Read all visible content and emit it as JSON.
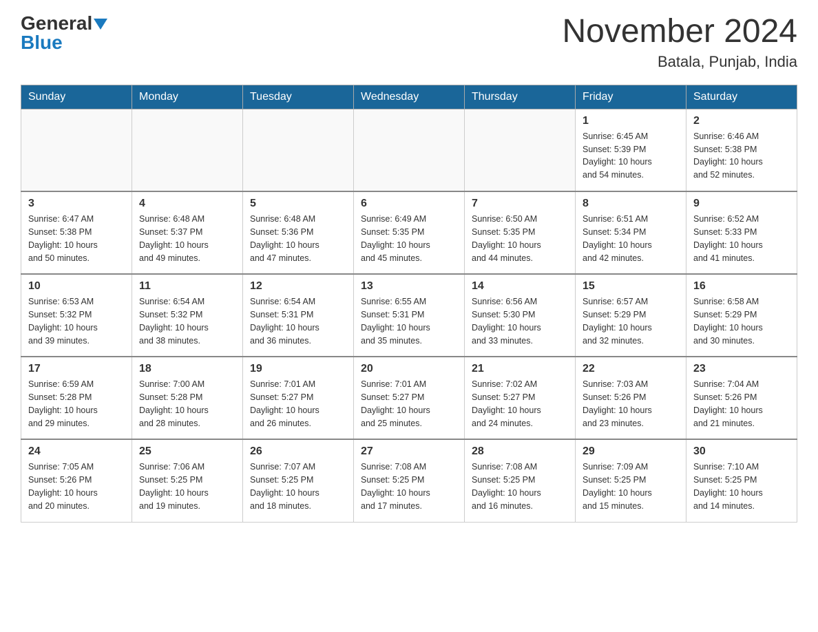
{
  "header": {
    "logo_general": "General",
    "logo_blue": "Blue",
    "month_title": "November 2024",
    "location": "Batala, Punjab, India"
  },
  "weekdays": [
    "Sunday",
    "Monday",
    "Tuesday",
    "Wednesday",
    "Thursday",
    "Friday",
    "Saturday"
  ],
  "weeks": [
    [
      {
        "day": "",
        "info": ""
      },
      {
        "day": "",
        "info": ""
      },
      {
        "day": "",
        "info": ""
      },
      {
        "day": "",
        "info": ""
      },
      {
        "day": "",
        "info": ""
      },
      {
        "day": "1",
        "info": "Sunrise: 6:45 AM\nSunset: 5:39 PM\nDaylight: 10 hours\nand 54 minutes."
      },
      {
        "day": "2",
        "info": "Sunrise: 6:46 AM\nSunset: 5:38 PM\nDaylight: 10 hours\nand 52 minutes."
      }
    ],
    [
      {
        "day": "3",
        "info": "Sunrise: 6:47 AM\nSunset: 5:38 PM\nDaylight: 10 hours\nand 50 minutes."
      },
      {
        "day": "4",
        "info": "Sunrise: 6:48 AM\nSunset: 5:37 PM\nDaylight: 10 hours\nand 49 minutes."
      },
      {
        "day": "5",
        "info": "Sunrise: 6:48 AM\nSunset: 5:36 PM\nDaylight: 10 hours\nand 47 minutes."
      },
      {
        "day": "6",
        "info": "Sunrise: 6:49 AM\nSunset: 5:35 PM\nDaylight: 10 hours\nand 45 minutes."
      },
      {
        "day": "7",
        "info": "Sunrise: 6:50 AM\nSunset: 5:35 PM\nDaylight: 10 hours\nand 44 minutes."
      },
      {
        "day": "8",
        "info": "Sunrise: 6:51 AM\nSunset: 5:34 PM\nDaylight: 10 hours\nand 42 minutes."
      },
      {
        "day": "9",
        "info": "Sunrise: 6:52 AM\nSunset: 5:33 PM\nDaylight: 10 hours\nand 41 minutes."
      }
    ],
    [
      {
        "day": "10",
        "info": "Sunrise: 6:53 AM\nSunset: 5:32 PM\nDaylight: 10 hours\nand 39 minutes."
      },
      {
        "day": "11",
        "info": "Sunrise: 6:54 AM\nSunset: 5:32 PM\nDaylight: 10 hours\nand 38 minutes."
      },
      {
        "day": "12",
        "info": "Sunrise: 6:54 AM\nSunset: 5:31 PM\nDaylight: 10 hours\nand 36 minutes."
      },
      {
        "day": "13",
        "info": "Sunrise: 6:55 AM\nSunset: 5:31 PM\nDaylight: 10 hours\nand 35 minutes."
      },
      {
        "day": "14",
        "info": "Sunrise: 6:56 AM\nSunset: 5:30 PM\nDaylight: 10 hours\nand 33 minutes."
      },
      {
        "day": "15",
        "info": "Sunrise: 6:57 AM\nSunset: 5:29 PM\nDaylight: 10 hours\nand 32 minutes."
      },
      {
        "day": "16",
        "info": "Sunrise: 6:58 AM\nSunset: 5:29 PM\nDaylight: 10 hours\nand 30 minutes."
      }
    ],
    [
      {
        "day": "17",
        "info": "Sunrise: 6:59 AM\nSunset: 5:28 PM\nDaylight: 10 hours\nand 29 minutes."
      },
      {
        "day": "18",
        "info": "Sunrise: 7:00 AM\nSunset: 5:28 PM\nDaylight: 10 hours\nand 28 minutes."
      },
      {
        "day": "19",
        "info": "Sunrise: 7:01 AM\nSunset: 5:27 PM\nDaylight: 10 hours\nand 26 minutes."
      },
      {
        "day": "20",
        "info": "Sunrise: 7:01 AM\nSunset: 5:27 PM\nDaylight: 10 hours\nand 25 minutes."
      },
      {
        "day": "21",
        "info": "Sunrise: 7:02 AM\nSunset: 5:27 PM\nDaylight: 10 hours\nand 24 minutes."
      },
      {
        "day": "22",
        "info": "Sunrise: 7:03 AM\nSunset: 5:26 PM\nDaylight: 10 hours\nand 23 minutes."
      },
      {
        "day": "23",
        "info": "Sunrise: 7:04 AM\nSunset: 5:26 PM\nDaylight: 10 hours\nand 21 minutes."
      }
    ],
    [
      {
        "day": "24",
        "info": "Sunrise: 7:05 AM\nSunset: 5:26 PM\nDaylight: 10 hours\nand 20 minutes."
      },
      {
        "day": "25",
        "info": "Sunrise: 7:06 AM\nSunset: 5:25 PM\nDaylight: 10 hours\nand 19 minutes."
      },
      {
        "day": "26",
        "info": "Sunrise: 7:07 AM\nSunset: 5:25 PM\nDaylight: 10 hours\nand 18 minutes."
      },
      {
        "day": "27",
        "info": "Sunrise: 7:08 AM\nSunset: 5:25 PM\nDaylight: 10 hours\nand 17 minutes."
      },
      {
        "day": "28",
        "info": "Sunrise: 7:08 AM\nSunset: 5:25 PM\nDaylight: 10 hours\nand 16 minutes."
      },
      {
        "day": "29",
        "info": "Sunrise: 7:09 AM\nSunset: 5:25 PM\nDaylight: 10 hours\nand 15 minutes."
      },
      {
        "day": "30",
        "info": "Sunrise: 7:10 AM\nSunset: 5:25 PM\nDaylight: 10 hours\nand 14 minutes."
      }
    ]
  ]
}
